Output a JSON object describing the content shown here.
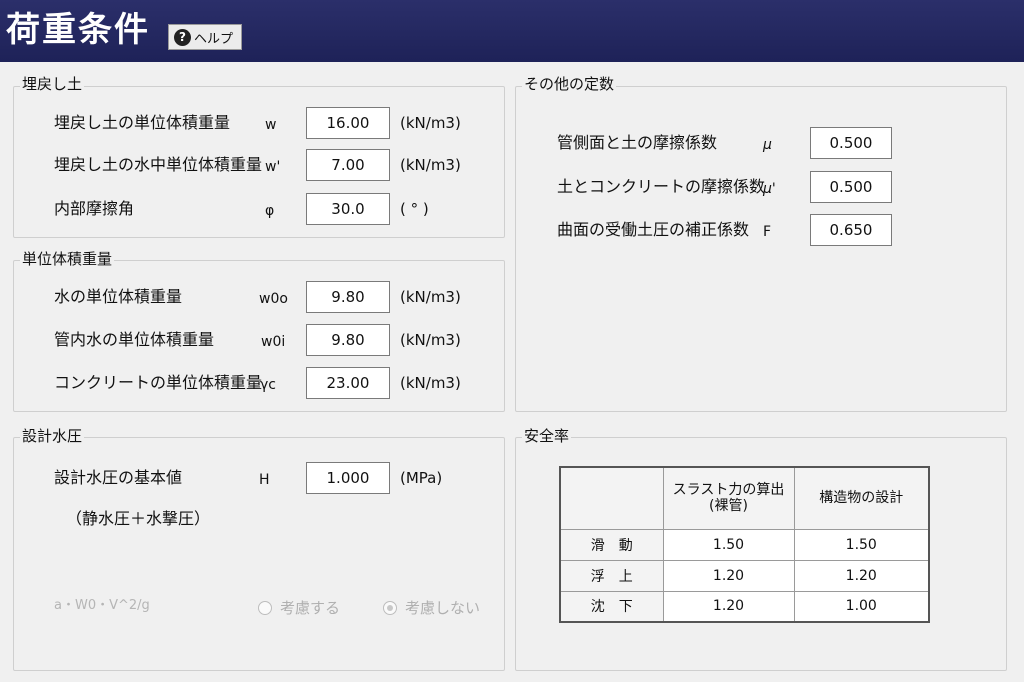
{
  "header": {
    "title": "荷重条件",
    "help_label": "ヘルプ"
  },
  "backfill": {
    "group_label": "埋戻し土",
    "rows": [
      {
        "label": "埋戻し土の単位体積重量",
        "symbol": "w",
        "value": "16.00",
        "unit": "(kN/m3)"
      },
      {
        "label": "埋戻し土の水中単位体積重量",
        "symbol": "w'",
        "value": "7.00",
        "unit": "(kN/m3)"
      },
      {
        "label": "内部摩擦角",
        "symbol": "φ",
        "value": "30.0",
        "unit": "( ° )"
      }
    ]
  },
  "unit_weight": {
    "group_label": "単位体積重量",
    "rows": [
      {
        "label": "水の単位体積重量",
        "symbol": "w0o",
        "value": "9.80",
        "unit": "(kN/m3)"
      },
      {
        "label": "管内水の単位体積重量",
        "symbol": "w0i",
        "value": "9.80",
        "unit": "(kN/m3)"
      },
      {
        "label": "コンクリートの単位体積重量",
        "symbol": "γc",
        "value": "23.00",
        "unit": "(kN/m3)"
      }
    ]
  },
  "design_pressure": {
    "group_label": "設計水圧",
    "label": "設計水圧の基本値",
    "sublabel": "（静水圧＋水撃圧）",
    "symbol": "H",
    "value": "1.000",
    "unit": "(MPa)",
    "formula": "a・W0・V^2/g",
    "option_consider": "考慮する",
    "option_not_consider": "考慮しない",
    "selected_option": "考慮しない"
  },
  "other_constants": {
    "group_label": "その他の定数",
    "rows": [
      {
        "label": "管側面と土の摩擦係数",
        "symbol": "μ",
        "value": "0.500"
      },
      {
        "label": "土とコンクリートの摩擦係数",
        "symbol": "μ'",
        "value": "0.500"
      },
      {
        "label": "曲面の受働土圧の補正係数",
        "symbol": "F",
        "value": "0.650"
      }
    ]
  },
  "safety": {
    "group_label": "安全率",
    "columns": [
      "スラスト力の算出\n(裸管)",
      "構造物の設計"
    ],
    "rows": [
      {
        "label": "滑動",
        "values": [
          "1.50",
          "1.50"
        ]
      },
      {
        "label": "浮上",
        "values": [
          "1.20",
          "1.20"
        ]
      },
      {
        "label": "沈下",
        "values": [
          "1.20",
          "1.00"
        ]
      }
    ]
  }
}
